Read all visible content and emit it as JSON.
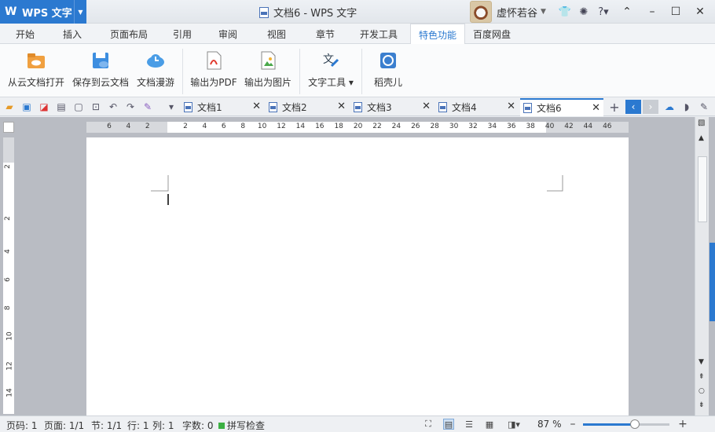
{
  "app": {
    "name": "WPS 文字",
    "title": "文档6 - WPS 文字"
  },
  "user": {
    "name": "虚怀若谷"
  },
  "menu_tabs": [
    "开始",
    "插入",
    "页面布局",
    "引用",
    "审阅",
    "视图",
    "章节",
    "开发工具",
    "特色功能",
    "百度网盘"
  ],
  "active_menu_tab": "特色功能",
  "ribbon": {
    "buttons": [
      {
        "label": "从云文档打开",
        "icon": "cloud-folder-icon"
      },
      {
        "label": "保存到云文档",
        "icon": "cloud-save-icon"
      },
      {
        "label": "文档漫游",
        "icon": "cloud-clock-icon"
      },
      {
        "label": "输出为PDF",
        "icon": "pdf-icon"
      },
      {
        "label": "输出为图片",
        "icon": "image-export-icon"
      },
      {
        "label": "文字工具",
        "icon": "text-tools-icon"
      },
      {
        "label": "稻壳儿",
        "icon": "docer-icon"
      }
    ]
  },
  "doc_tabs": [
    "文档1",
    "文档2",
    "文档3",
    "文档4",
    "文档6"
  ],
  "active_doc_tab": "文档6",
  "ruler": {
    "h_ticks": [
      "6",
      "4",
      "2",
      "2",
      "4",
      "6",
      "8",
      "10",
      "12",
      "14",
      "16",
      "18",
      "20",
      "22",
      "24",
      "26",
      "28",
      "30",
      "32",
      "34",
      "36",
      "38",
      "40",
      "42",
      "44",
      "46"
    ],
    "v_ticks": [
      "2",
      "2",
      "4",
      "6",
      "8",
      "10",
      "12",
      "14"
    ]
  },
  "status": {
    "page_num": "页码: 1",
    "pages": "页面: 1/1",
    "section": "节: 1/1",
    "row": "行: 1",
    "col": "列: 1",
    "word_count": "字数: 0",
    "spell_check": "拼写检查",
    "zoom": "87 %"
  },
  "zoom_level": 0.6,
  "colors": {
    "accent": "#2b79d0",
    "spell_ok": "#3cb043"
  }
}
